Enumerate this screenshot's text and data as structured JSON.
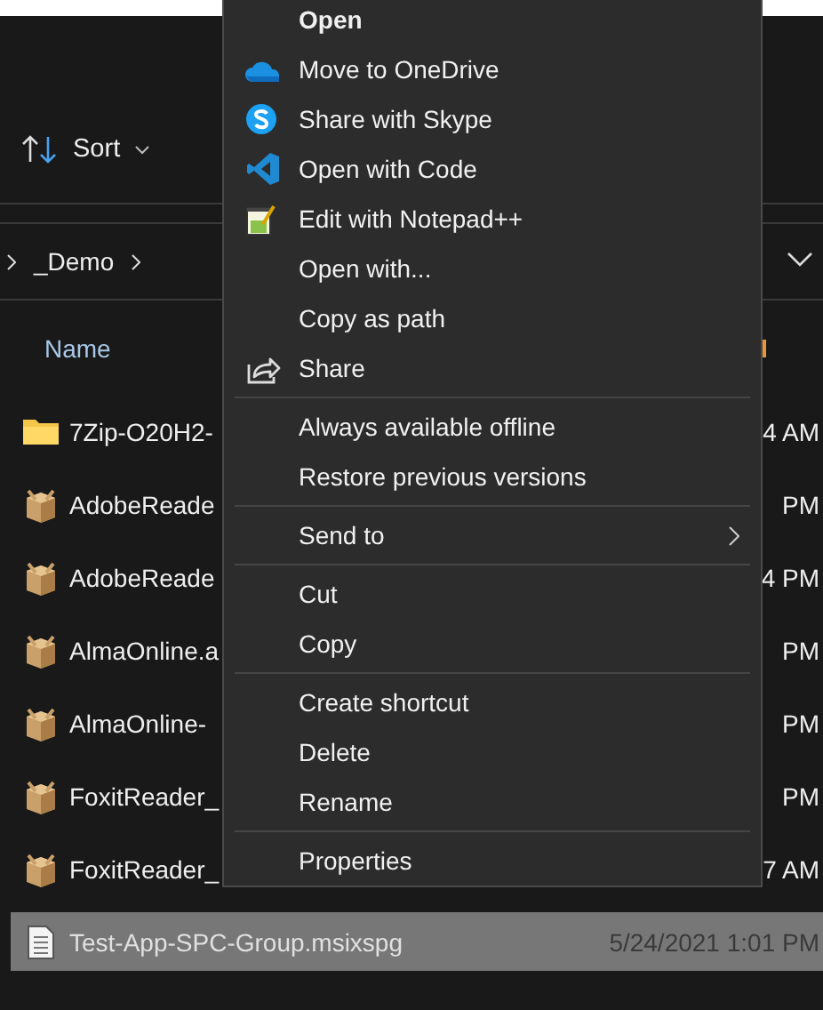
{
  "toolbar": {
    "sort_label": "Sort"
  },
  "breadcrumb": {
    "folder": "_Demo"
  },
  "columns": {
    "name": "Name"
  },
  "files": [
    {
      "name": "7Zip-O20H2-",
      "modified": "4 AM",
      "kind": "folder",
      "selected": false
    },
    {
      "name": "AdobeReade",
      "modified": "PM",
      "kind": "package",
      "selected": false
    },
    {
      "name": "AdobeReade",
      "modified": "4 PM",
      "kind": "package",
      "selected": false
    },
    {
      "name": "AlmaOnline.a",
      "modified": "PM",
      "kind": "package",
      "selected": false
    },
    {
      "name": "AlmaOnline-",
      "modified": "PM",
      "kind": "package",
      "selected": false
    },
    {
      "name": "FoxitReader_",
      "modified": "PM",
      "kind": "package",
      "selected": false
    },
    {
      "name": "FoxitReader_",
      "modified": "7 AM",
      "kind": "package",
      "selected": false
    },
    {
      "name": "Test-App-SPC-Group.msixspg",
      "modified": "5/24/2021 1:01 PM",
      "kind": "document",
      "selected": true
    }
  ],
  "context_menu": {
    "sections": [
      [
        {
          "label": "Open",
          "default": true,
          "submenu": false
        },
        {
          "label": "Move to OneDrive",
          "default": false,
          "submenu": false
        },
        {
          "label": "Share with Skype",
          "default": false,
          "submenu": false
        },
        {
          "label": "Open with Code",
          "default": false,
          "submenu": false
        },
        {
          "label": "Edit with Notepad++",
          "default": false,
          "submenu": false
        },
        {
          "label": "Open with...",
          "default": false,
          "submenu": false
        },
        {
          "label": "Copy as path",
          "default": false,
          "submenu": false
        },
        {
          "label": "Share",
          "default": false,
          "submenu": false
        }
      ],
      [
        {
          "label": "Always available offline",
          "default": false,
          "submenu": false
        },
        {
          "label": "Restore previous versions",
          "default": false,
          "submenu": false
        }
      ],
      [
        {
          "label": "Send to",
          "default": false,
          "submenu": true
        }
      ],
      [
        {
          "label": "Cut",
          "default": false,
          "submenu": false
        },
        {
          "label": "Copy",
          "default": false,
          "submenu": false
        }
      ],
      [
        {
          "label": "Create shortcut",
          "default": false,
          "submenu": false
        },
        {
          "label": "Delete",
          "default": false,
          "submenu": false
        },
        {
          "label": "Rename",
          "default": false,
          "submenu": false
        }
      ],
      [
        {
          "label": "Properties",
          "default": false,
          "submenu": false
        }
      ]
    ]
  }
}
